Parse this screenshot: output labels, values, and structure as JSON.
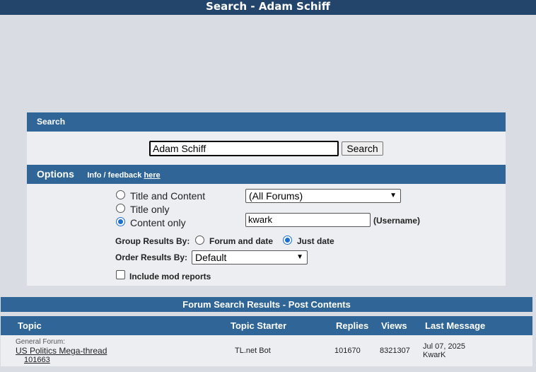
{
  "page_title": "Search - Adam Schiff",
  "search": {
    "header": "Search",
    "query": "Adam Schiff",
    "button_label": "Search"
  },
  "options": {
    "header": "Options",
    "info_label": "Info / feedback",
    "info_link": "here",
    "scope_options": [
      "Title and Content",
      "Title only",
      "Content only"
    ],
    "scope_selected": "Content only",
    "forum_select": "(All Forums)",
    "username_value": "kwark",
    "username_label": "(Username)",
    "group_label": "Group Results By:",
    "group_options": [
      "Forum and date",
      "Just date"
    ],
    "group_selected": "Just date",
    "order_label": "Order Results By:",
    "order_select": "Default",
    "mod_reports_label": "Include mod reports",
    "mod_reports_checked": false
  },
  "results": {
    "header": "Forum Search Results - Post Contents",
    "columns": {
      "topic": "Topic",
      "starter": "Topic Starter",
      "replies": "Replies",
      "views": "Views",
      "last": "Last Message"
    },
    "rows": [
      {
        "forum": "General Forum:",
        "topic": "US Politics Mega-thread",
        "post_number": "101663",
        "starter": "TL.net Bot",
        "replies": "101670",
        "views": "8321307",
        "last_date": "Jul 07, 2025",
        "last_user": "KwarK"
      }
    ]
  }
}
